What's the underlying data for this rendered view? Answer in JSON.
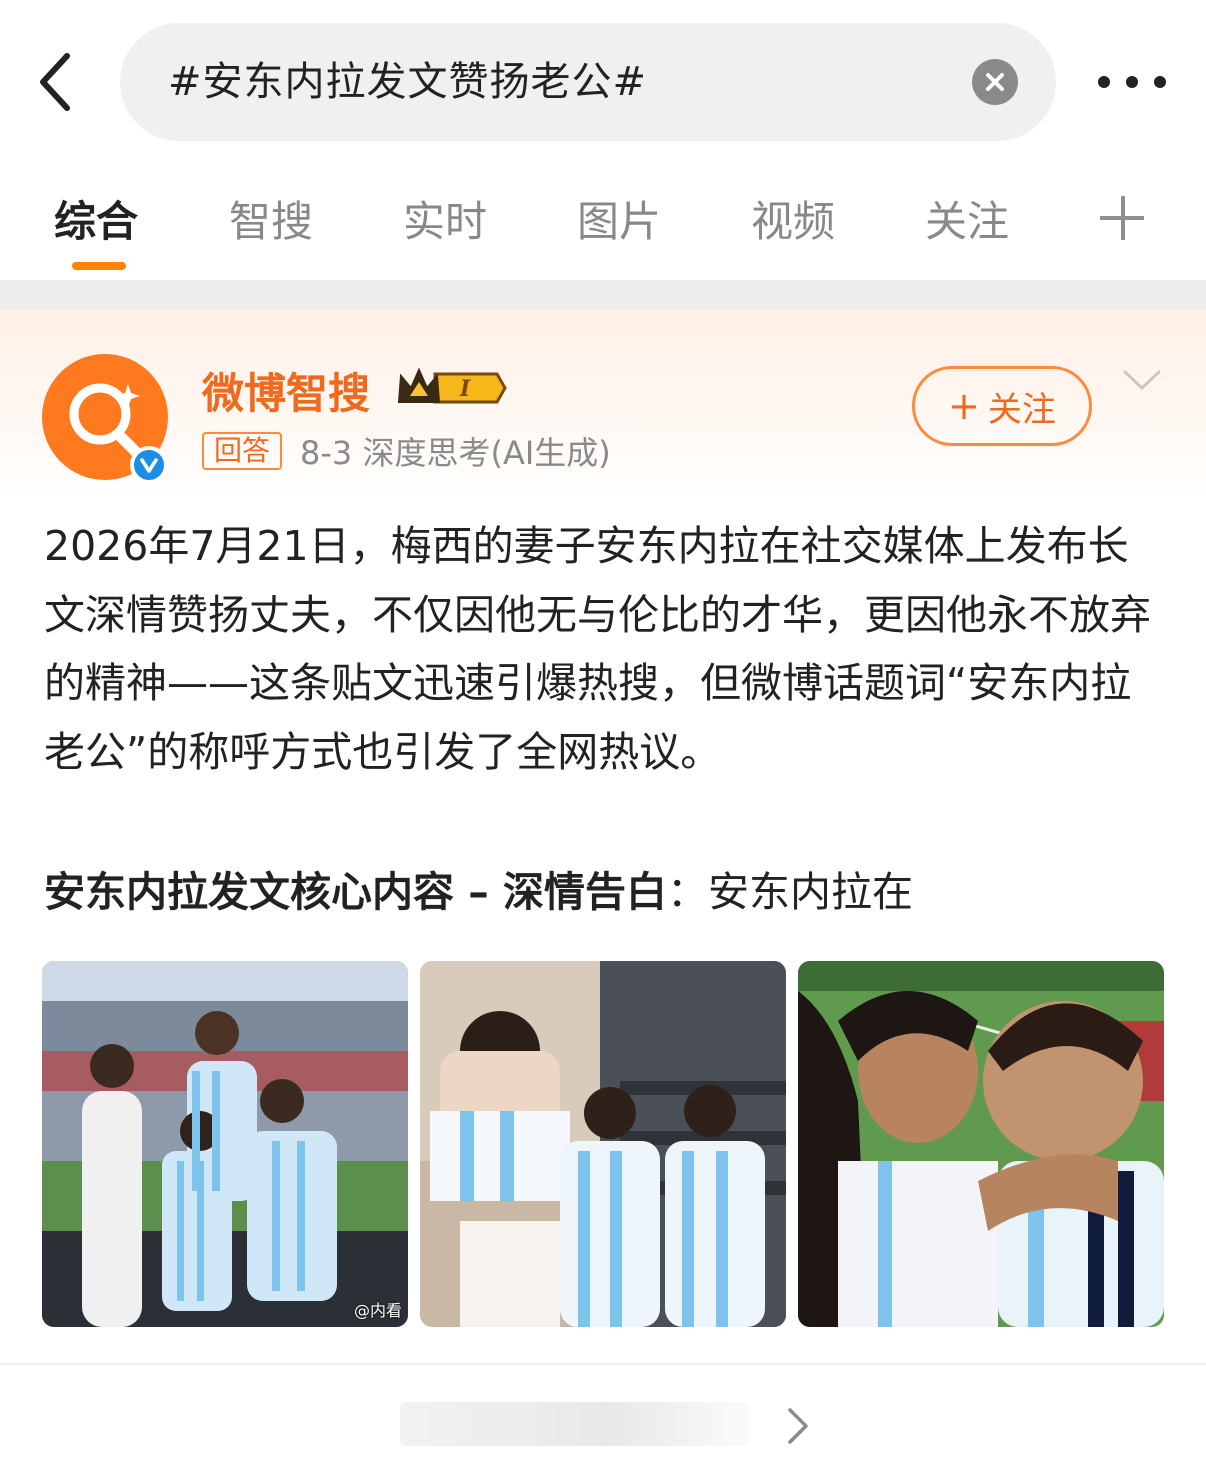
{
  "search": {
    "query": "#安东内拉发文赞扬老公#"
  },
  "tabs": [
    {
      "label": "综合",
      "active": true
    },
    {
      "label": "智搜"
    },
    {
      "label": "实时"
    },
    {
      "label": "图片"
    },
    {
      "label": "视频"
    },
    {
      "label": "关注"
    }
  ],
  "post": {
    "author": "微博智搜",
    "badge_text": "I",
    "tag": "回答",
    "meta": "8-3  深度思考(AI生成)",
    "follow_label": "关注",
    "body": "2026年7月21日，梅西的妻子安东内拉在社交媒体上发布长文深情赞扬丈夫，不仅因他无与伦比的才华，更因他永不放弃的精神——这条贴文迅速引爆热搜，但微博话题词“安东内拉老公”的称呼方式也引发了全网热议。",
    "subhead_bold": "安东内拉发文核心内容 – 深情告白",
    "subhead_rest": "：安东内拉在",
    "photo_watermark": "@内看"
  },
  "colors": {
    "accent": "#ff8200",
    "author": "#f0691d",
    "verified": "#1e8de6",
    "jersey_blue": "#7ec3ec"
  },
  "icons": {
    "back": "back-arrow-icon",
    "clear": "clear-icon",
    "more": "more-dots-icon",
    "add_tab": "plus-icon",
    "avatar": "search-sparkle-icon",
    "verified": "verified-icon",
    "badge": "crown-icon",
    "collapse": "chevron-down-icon",
    "next": "chevron-right-icon"
  }
}
